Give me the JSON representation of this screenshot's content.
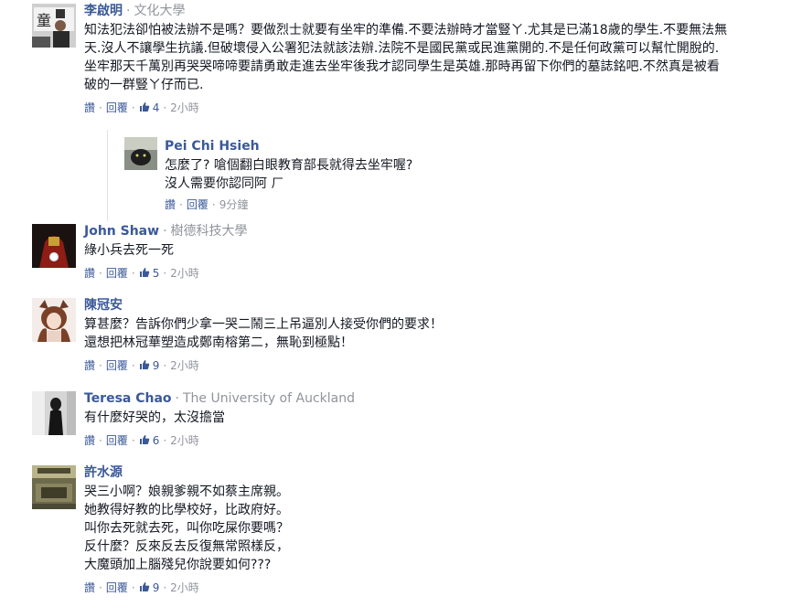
{
  "actions": {
    "read": "讚",
    "reply": "回覆",
    "dot": "·"
  },
  "colors": {
    "link": "#3b5998",
    "meta": "#90949c",
    "text": "#141823"
  },
  "comments": [
    {
      "name": "李啟明",
      "affiliation": "文化大學",
      "lines": [
        "知法犯法卻怕被法辦不是嗎？要做烈士就要有坐牢的準備.不要法辦時才當豎ㄚ.尤其是已滿18歲的學生.不要無法無",
        "天.沒人不讓學生抗議.但破壞侵入公署犯法就該法辦.法院不是國民黨或民進黨開的.不是任何政黨可以幫忙開脫的.",
        "坐牢那天千萬別再哭哭啼啼要請勇敢走進去坐牢後我才認同學生是英雄.那時再留下你們的墓誌銘吧.不然真是被看",
        "破的一群豎ㄚ仔而已."
      ],
      "likes": "4",
      "time": "2小時",
      "avatar_icon": "profile-photo-icon"
    },
    {
      "name": "Pei Chi Hsieh",
      "affiliation": "",
      "lines": [
        "怎麼了? 嗆個翻白眼教育部長就得去坐牢喔?",
        "沒人需要你認同阿 ㄏ"
      ],
      "likes": "",
      "time": "9分鐘",
      "avatar_icon": "profile-photo-icon"
    },
    {
      "name": "John Shaw",
      "affiliation": "樹德科技大學",
      "lines": [
        "綠小兵去死一死"
      ],
      "likes": "5",
      "time": "2小時",
      "avatar_icon": "profile-photo-icon"
    },
    {
      "name": "陳冠安",
      "affiliation": "",
      "lines": [
        "算甚麼？告訴你們少拿一哭二鬧三上吊逼別人接受你們的要求！",
        "還想把林冠華塑造成鄭南榕第二，無恥到極點！"
      ],
      "likes": "9",
      "time": "2小時",
      "avatar_icon": "profile-photo-icon"
    },
    {
      "name": "Teresa Chao",
      "affiliation": "The University of Auckland",
      "lines": [
        "有什麼好哭的，太沒擔當"
      ],
      "likes": "6",
      "time": "2小時",
      "avatar_icon": "profile-photo-icon"
    },
    {
      "name": "許水源",
      "affiliation": "",
      "lines": [
        "哭三小啊？娘親爹親不如蔡主席親。",
        "她教得好教的比學校好，比政府好。",
        "叫你去死就去死，叫你吃屎你要嗎？",
        "反什麼？反來反去反復無常照樣反，",
        "大魔頭加上腦殘兒你說要如何???"
      ],
      "likes": "9",
      "time": "2小時",
      "avatar_icon": "profile-photo-icon"
    }
  ]
}
